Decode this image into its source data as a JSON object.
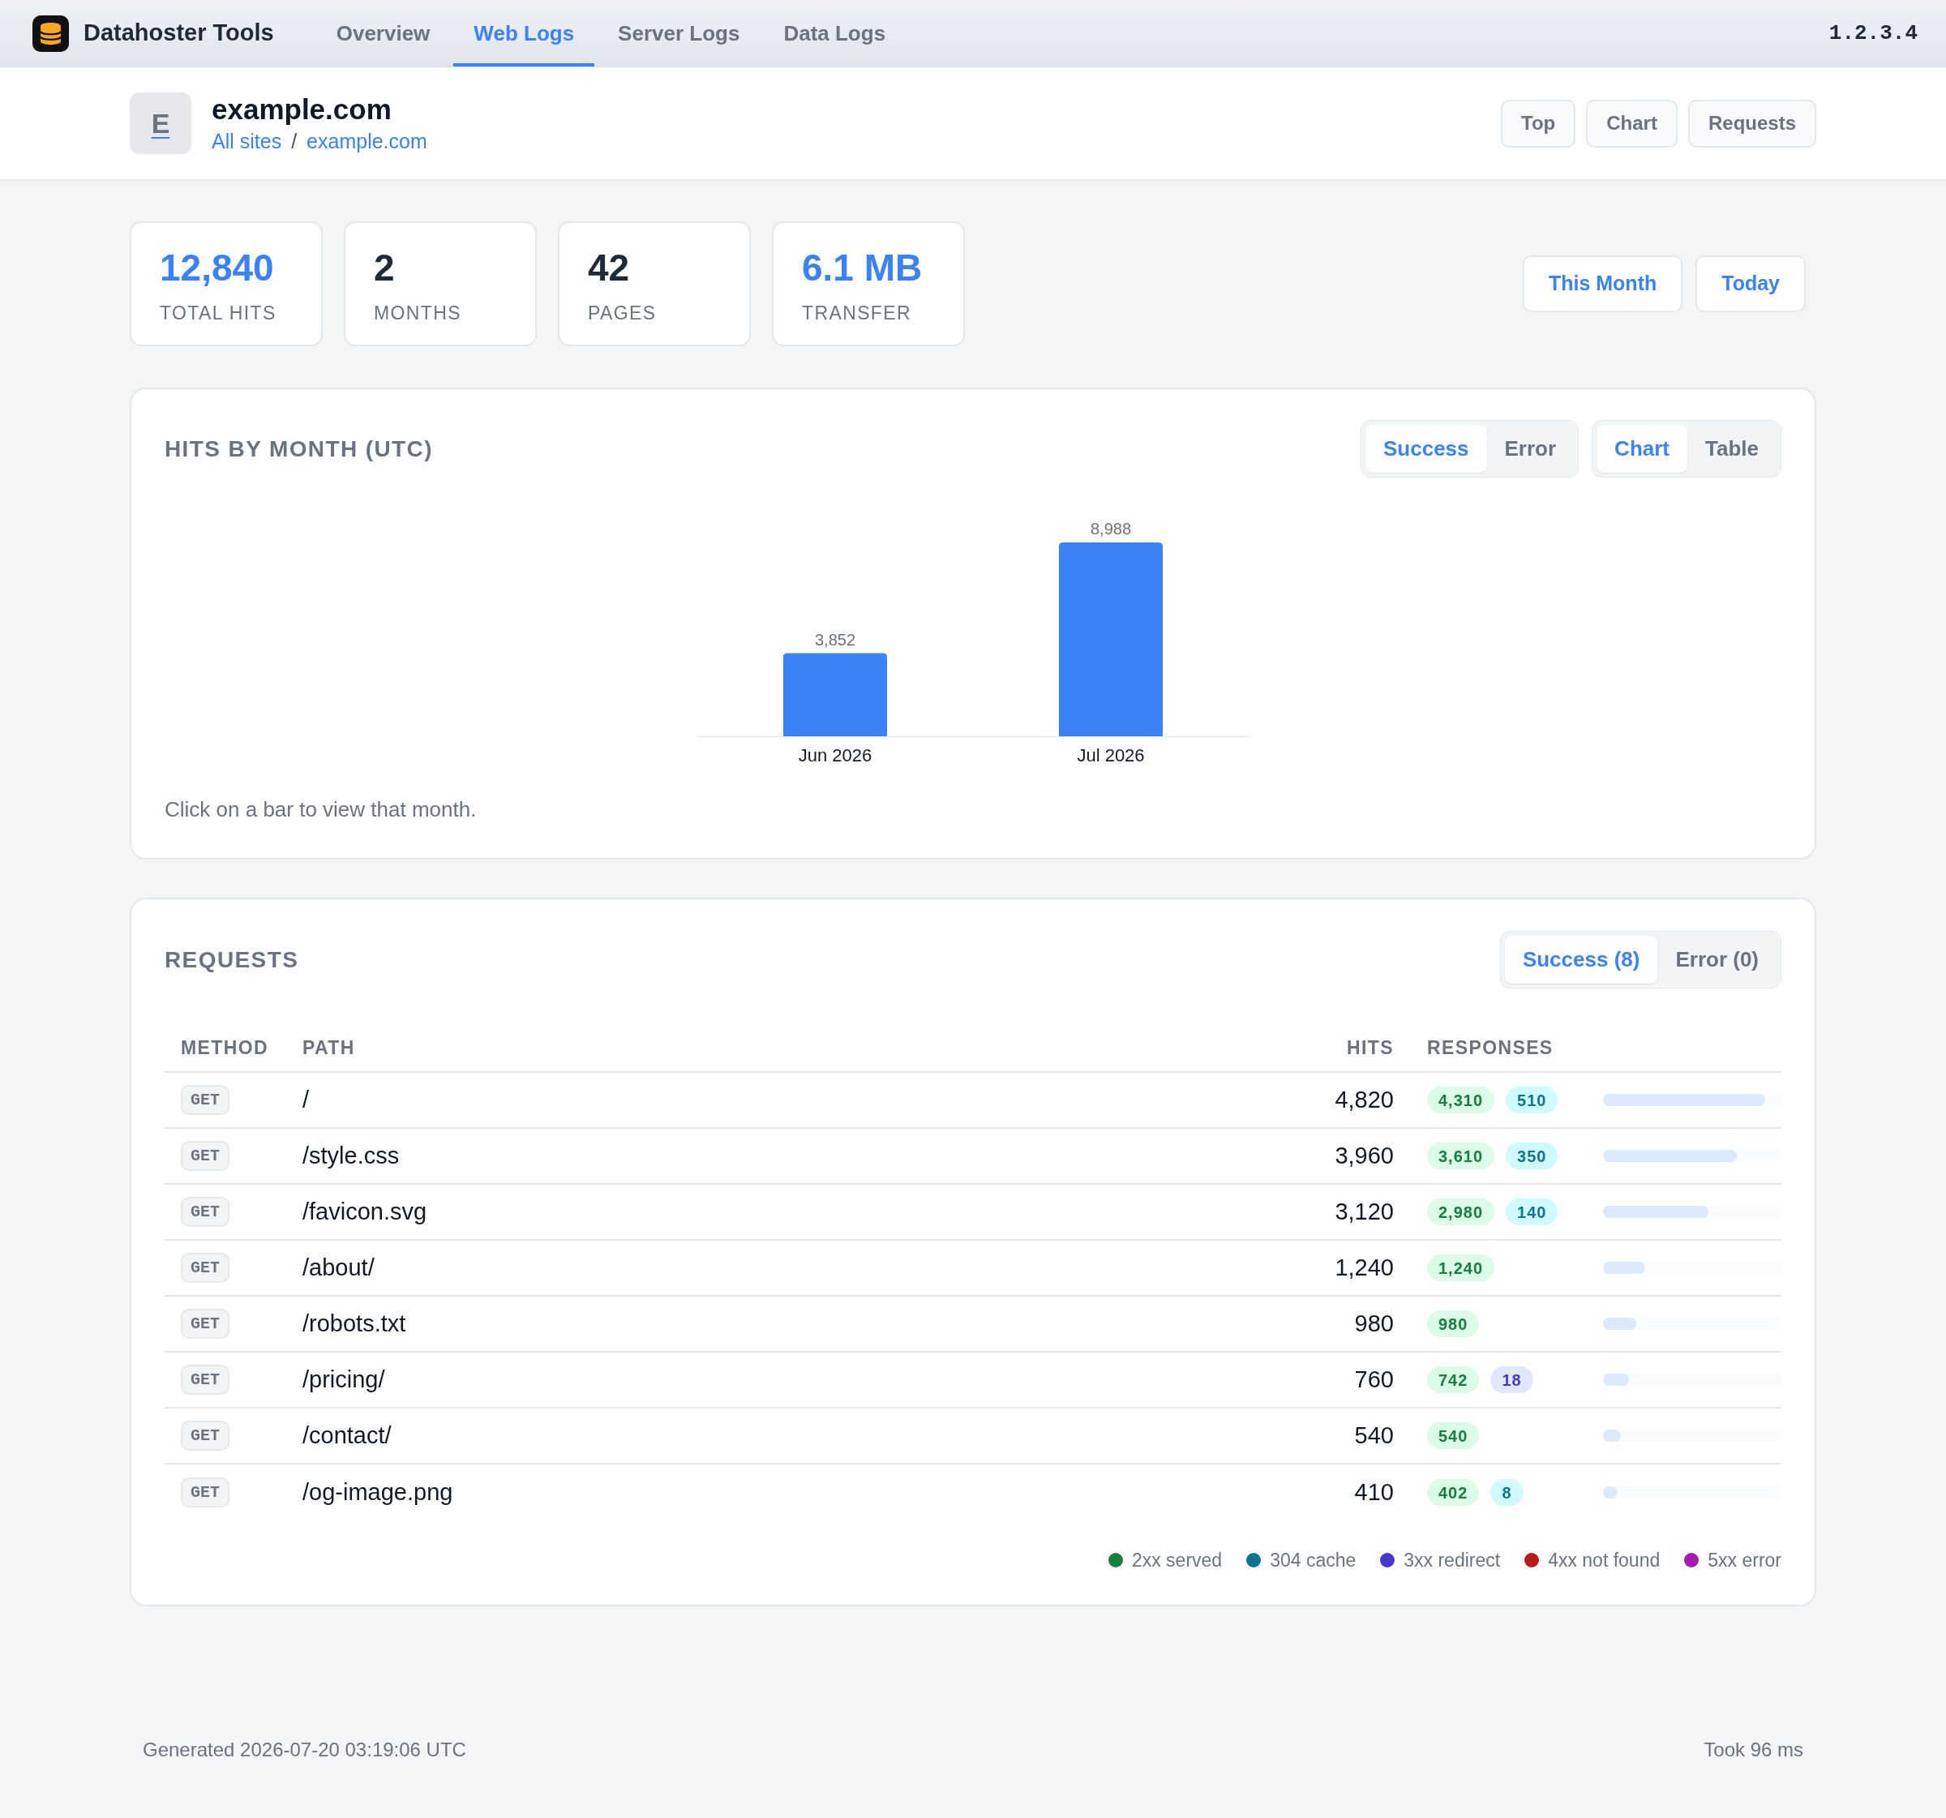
{
  "nav": {
    "brand": "Datahoster Tools",
    "tabs": [
      {
        "label": "Overview",
        "selected": false
      },
      {
        "label": "Web Logs",
        "selected": true
      },
      {
        "label": "Server Logs",
        "selected": false
      },
      {
        "label": "Data Logs",
        "selected": false
      }
    ],
    "version": "1.2.3.4"
  },
  "site": {
    "avatar_letter": "E",
    "title": "example.com",
    "breadcrumb": {
      "items": [
        "All sites",
        "example.com"
      ],
      "separator": "/"
    },
    "buttons": [
      "Top",
      "Chart",
      "Requests"
    ]
  },
  "stats": [
    {
      "value": "12,840",
      "label": "TOTAL HITS",
      "highlighted": true
    },
    {
      "value": "2",
      "label": "MONTHS",
      "highlighted": false
    },
    {
      "value": "42",
      "label": "PAGES",
      "highlighted": false
    },
    {
      "value": "6.1 MB",
      "label": "TRANSFER",
      "highlighted": true
    }
  ],
  "range_buttons": [
    "This Month",
    "Today"
  ],
  "hits_chart": {
    "title": "HITS BY MONTH (UTC)",
    "filter_tabs": [
      {
        "label": "Success",
        "selected": true
      },
      {
        "label": "Error",
        "selected": false
      }
    ],
    "view_tabs": [
      {
        "label": "Chart",
        "selected": true
      },
      {
        "label": "Table",
        "selected": false
      }
    ],
    "chart_data": {
      "type": "bar",
      "categories": [
        "Jun 2026",
        "Jul 2026"
      ],
      "values": [
        3852,
        8988
      ],
      "value_labels": [
        "3,852",
        "8,988"
      ]
    },
    "hint": "Click on a bar to view that month."
  },
  "requests": {
    "title": "REQUESTS",
    "tabs": [
      {
        "label": "Success (8)",
        "selected": true
      },
      {
        "label": "Error (0)",
        "selected": false
      }
    ],
    "columns": [
      "METHOD",
      "PATH",
      "HITS",
      "RESPONSES"
    ],
    "rows": [
      {
        "method": "GET",
        "path": "/",
        "hits": "4,820",
        "responses": [
          {
            "kind": "served",
            "count": "4,310"
          },
          {
            "kind": "cache",
            "count": "510"
          }
        ],
        "level": 0.91
      },
      {
        "method": "GET",
        "path": "/style.css",
        "hits": "3,960",
        "responses": [
          {
            "kind": "served",
            "count": "3,610"
          },
          {
            "kind": "cache",
            "count": "350"
          }
        ],
        "level": 0.75
      },
      {
        "method": "GET",
        "path": "/favicon.svg",
        "hits": "3,120",
        "responses": [
          {
            "kind": "served",
            "count": "2,980"
          },
          {
            "kind": "cache",
            "count": "140"
          }
        ],
        "level": 0.59
      },
      {
        "method": "GET",
        "path": "/about/",
        "hits": "1,240",
        "responses": [
          {
            "kind": "served",
            "count": "1,240"
          }
        ],
        "level": 0.235
      },
      {
        "method": "GET",
        "path": "/robots.txt",
        "hits": "980",
        "responses": [
          {
            "kind": "served",
            "count": "980"
          }
        ],
        "level": 0.185
      },
      {
        "method": "GET",
        "path": "/pricing/",
        "hits": "760",
        "responses": [
          {
            "kind": "served",
            "count": "742"
          },
          {
            "kind": "redirect",
            "count": "18"
          }
        ],
        "level": 0.145
      },
      {
        "method": "GET",
        "path": "/contact/",
        "hits": "540",
        "responses": [
          {
            "kind": "served",
            "count": "540"
          }
        ],
        "level": 0.1
      },
      {
        "method": "GET",
        "path": "/og-image.png",
        "hits": "410",
        "responses": [
          {
            "kind": "served",
            "count": "402"
          },
          {
            "kind": "cache",
            "count": "8"
          }
        ],
        "level": 0.08
      }
    ],
    "legend": [
      {
        "label": "2xx served",
        "color": "#15803d"
      },
      {
        "label": "304 cache",
        "color": "#0e7490"
      },
      {
        "label": "3xx redirect",
        "color": "#4338ca"
      },
      {
        "label": "4xx not found",
        "color": "#b91c1c"
      },
      {
        "label": "5xx error",
        "color": "#a21caf"
      }
    ]
  },
  "footer": {
    "generated": "Generated 2026-07-20 03:19:06 UTC",
    "took": "Took 96 ms"
  }
}
